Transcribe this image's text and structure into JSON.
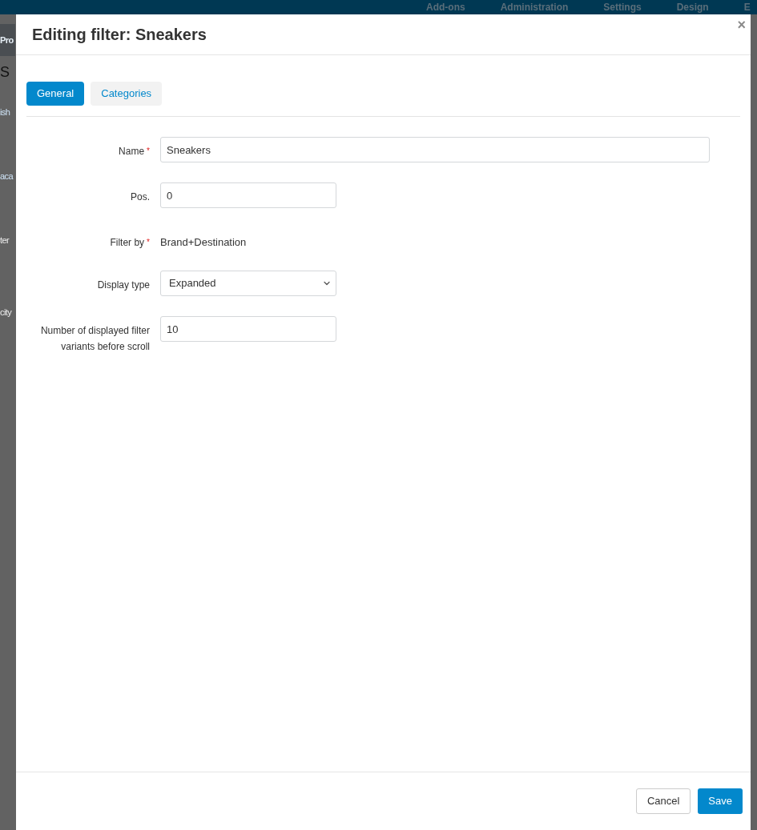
{
  "background": {
    "nav_items": [
      "Add-ons",
      "Administration",
      "Settings",
      "Design",
      "E"
    ],
    "side_fragments": [
      {
        "text": "Pro",
        "kind": "bar"
      },
      {
        "text": "S",
        "kind": "heading"
      },
      {
        "text": "ish",
        "kind": "link"
      },
      {
        "text": "aca",
        "kind": "link"
      },
      {
        "text": "ter",
        "kind": "muted"
      },
      {
        "text": "city",
        "kind": "muted"
      }
    ]
  },
  "dialog": {
    "title": "Editing filter: Sneakers",
    "close": "×",
    "tabs": [
      {
        "label": "General",
        "selected": true
      },
      {
        "label": "Categories",
        "selected": false
      }
    ],
    "fields": [
      {
        "kind": "wide_input",
        "label": "Name",
        "required_mark": "*",
        "value": "Sneakers"
      },
      {
        "kind": "input",
        "label": "Pos.",
        "value": "0"
      },
      {
        "kind": "text",
        "label": "Filter by",
        "required_mark": "*",
        "value": "Brand+Destination"
      },
      {
        "kind": "select",
        "label": "Display type",
        "value": "Expanded"
      },
      {
        "kind": "input",
        "label": "Number of displayed filter variants before scroll",
        "value": "10"
      }
    ],
    "buttons": [
      {
        "label": "Cancel",
        "kind": "secondary"
      },
      {
        "label": "Save",
        "kind": "primary"
      }
    ]
  }
}
